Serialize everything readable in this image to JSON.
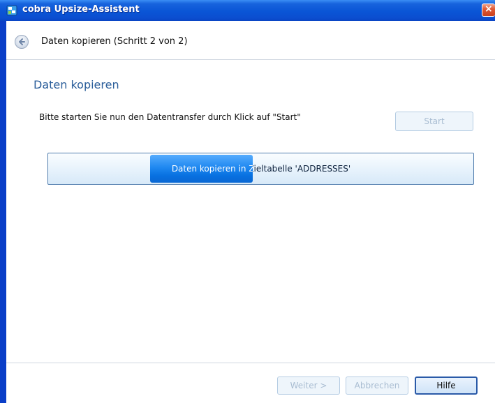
{
  "window": {
    "title": "cobra Upsize-Assistent",
    "close_glyph": "×"
  },
  "header": {
    "title": "Daten kopieren (Schritt 2 von 2)",
    "back_icon": "back-arrow-icon"
  },
  "content": {
    "section_title": "Daten kopieren",
    "instruction": "Bitte starten Sie nun den Datentransfer durch Klick auf \"Start\"",
    "start_label": "Start",
    "progress": {
      "label": "Daten kopieren in Zieltabelle 'ADDRESSES'",
      "fraction": 0.24
    }
  },
  "footer": {
    "next_label": "Weiter >",
    "cancel_label": "Abbrechen",
    "help_label": "Hilfe"
  },
  "colors": {
    "titlebar": "#0a55d6",
    "accent_title": "#2b5e9a",
    "progress_fill": "#1d87f0"
  }
}
